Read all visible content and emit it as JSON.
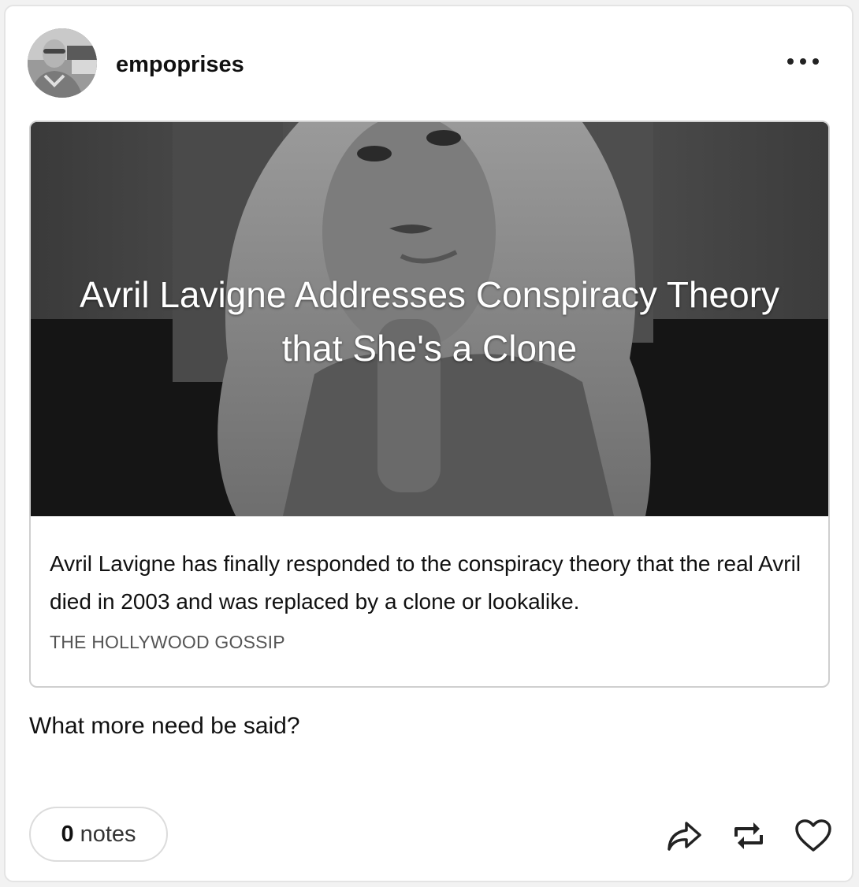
{
  "post": {
    "username": "empoprises",
    "card": {
      "title": "Avril Lavigne Addresses Conspiracy Theory that She's a Clone",
      "description": "Avril Lavigne has finally responded to the conspiracy theory that the real Avril died in 2003 and was replaced by a clone or lookalike.",
      "source": "THE HOLLYWOOD GOSSIP"
    },
    "caption": "What more need be said?",
    "notes": {
      "count": "0",
      "label": "notes"
    },
    "icons": {
      "more": "more-options-icon",
      "share": "share-icon",
      "reblog": "reblog-icon",
      "like": "heart-icon"
    }
  }
}
